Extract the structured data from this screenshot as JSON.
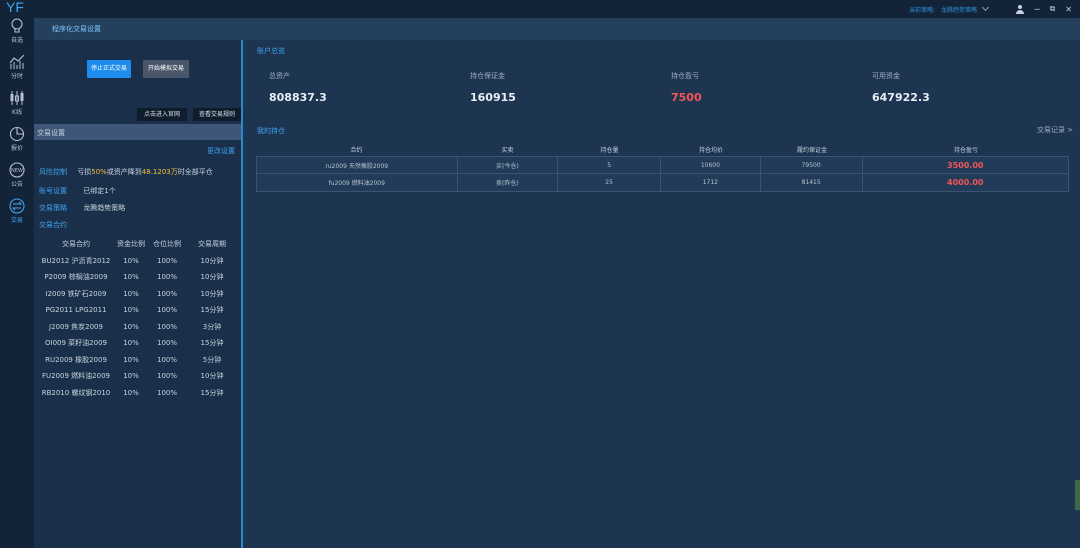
{
  "app": {
    "logo": "YF",
    "strategy_label": "当前策略:",
    "strategy_value": "龙腾趋势策略",
    "window_title": "程序化交易设置"
  },
  "nav": [
    {
      "label": "自选"
    },
    {
      "label": "分时"
    },
    {
      "label": "K线"
    },
    {
      "label": "报价"
    },
    {
      "label": "公告"
    },
    {
      "label": "交易"
    }
  ],
  "left": {
    "stop_btn": "停止正式交易",
    "sim_btn": "开始模拟交易",
    "official_btn": "点击进入官网",
    "rules_btn": "查看交易规则",
    "section_title": "交易设置",
    "edit_link": "更改设置",
    "risk_label": "风险控制",
    "risk_pre": "亏损",
    "risk_pct": "50%",
    "risk_mid": "或资产降到",
    "risk_amt": "48.1203万",
    "risk_post": "时全部平仓",
    "account_label": "账号设置",
    "account_value": "已绑定1个",
    "strategy_label": "交易策略",
    "strategy_value": "龙腾趋势策略",
    "contract_label": "交易合约",
    "table_headers": [
      "交易合约",
      "资金比例",
      "仓位比例",
      "交易周期"
    ],
    "contracts": [
      [
        "BU2012  沪沥青2012",
        "10%",
        "100%",
        "10分钟"
      ],
      [
        "P2009  棕榈油2009",
        "10%",
        "100%",
        "10分钟"
      ],
      [
        "I2009  铁矿石2009",
        "10%",
        "100%",
        "10分钟"
      ],
      [
        "PG2011  LPG2011",
        "10%",
        "100%",
        "15分钟"
      ],
      [
        "J2009  焦炭2009",
        "10%",
        "100%",
        "3分钟"
      ],
      [
        "OI009  菜籽油2009",
        "10%",
        "100%",
        "15分钟"
      ],
      [
        "RU2009  橡胶2009",
        "10%",
        "100%",
        "5分钟"
      ],
      [
        "FU2009  燃料油2009",
        "10%",
        "100%",
        "10分钟"
      ],
      [
        "RB2010  螺纹钢2010",
        "10%",
        "100%",
        "15分钟"
      ]
    ]
  },
  "overview": {
    "title": "账户总览",
    "stats": [
      {
        "label": "总资产",
        "value": "808837.3"
      },
      {
        "label": "持仓保证金",
        "value": "160915"
      },
      {
        "label": "持仓盈亏",
        "value": "7500"
      },
      {
        "label": "可用资金",
        "value": "647922.3"
      }
    ]
  },
  "positions": {
    "title": "我的持仓",
    "records_link": "交易记录 >",
    "headers": [
      "合约",
      "买卖",
      "持仓量",
      "持仓均价",
      "履约保证金",
      "持仓盈亏"
    ],
    "rows": [
      [
        "ru2009 天然橡胶2009",
        "买(今仓)",
        "5",
        "10600",
        "79500",
        "3500.00"
      ],
      [
        "fu2009 燃料油2009",
        "卖(昨仓)",
        "25",
        "1712",
        "81415",
        "4000.00"
      ]
    ]
  },
  "colors": {
    "accent": "#3fa4f0",
    "profit_red": "#f25656",
    "highlight_yellow": "#f5c036"
  }
}
